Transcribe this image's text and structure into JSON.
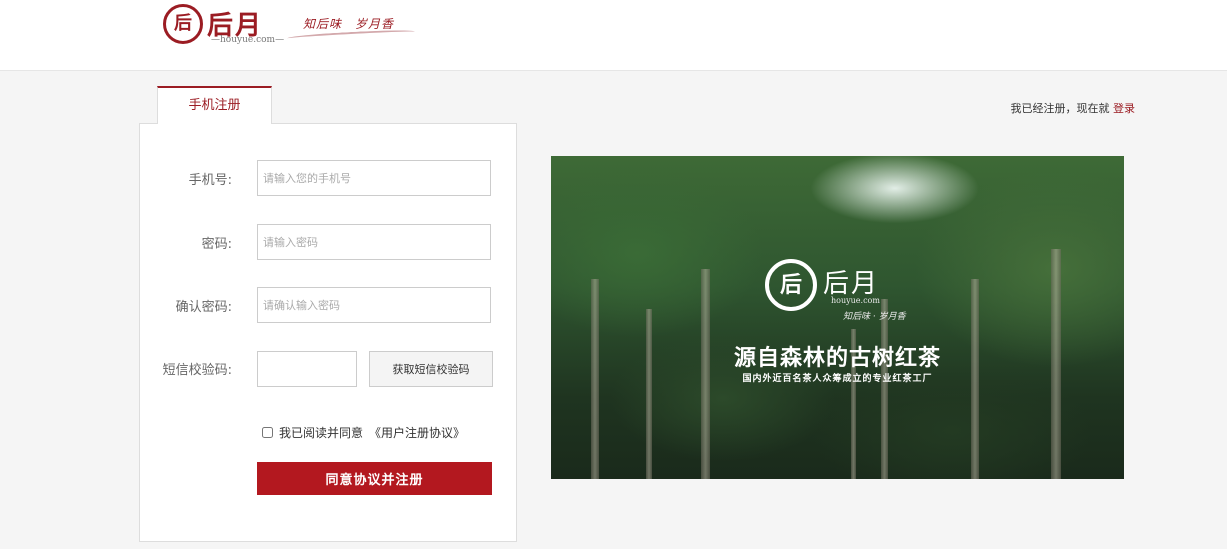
{
  "header": {
    "logo_mark": "后",
    "brand_name": "后月",
    "domain": "—houyue.com—",
    "slogan": "知后味　岁月香"
  },
  "tab": {
    "label": "手机注册"
  },
  "login_hint": {
    "text": "我已经注册，现在就 ",
    "link": "登录"
  },
  "form": {
    "phone": {
      "label": "手机号:",
      "placeholder": "请输入您的手机号"
    },
    "password": {
      "label": "密码:",
      "placeholder": "请输入密码"
    },
    "confirm": {
      "label": "确认密码:",
      "placeholder": "请确认输入密码"
    },
    "sms": {
      "label": "短信校验码:",
      "placeholder": "",
      "button": "获取短信校验码"
    },
    "agree": {
      "text": "我已阅读并同意",
      "agreement": "《用户注册协议》"
    },
    "submit": "同意协议并注册"
  },
  "banner": {
    "logo_mark": "后",
    "brand_name": "后月",
    "domain": "houyue.com",
    "slogan": "知后味 · 岁月香",
    "headline": "源自森林的古树红茶",
    "subheadline": "国内外近百名茶人众筹成立的专业红茶工厂"
  }
}
